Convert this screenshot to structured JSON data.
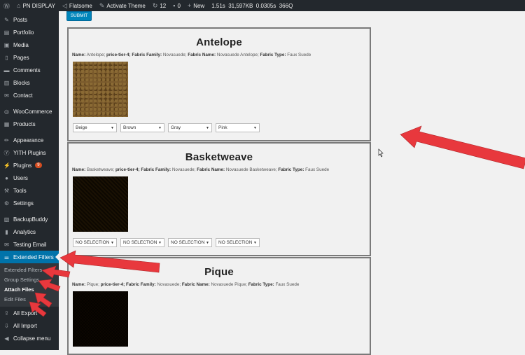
{
  "adminbar": {
    "wp_icon": "wordpress-icon",
    "site": "PN DISPLAY",
    "theme": "Flatsome",
    "activate": "Activate Theme",
    "updates": "12",
    "comments": "0",
    "new": "New",
    "perf": "1.51s  31,597KB  0.0305s  366Q"
  },
  "sidebar": {
    "items": [
      {
        "label": "Posts",
        "icon": "pin-icon"
      },
      {
        "label": "Portfolio",
        "icon": "portfolio-icon"
      },
      {
        "label": "Media",
        "icon": "media-icon"
      },
      {
        "label": "Pages",
        "icon": "pages-icon"
      },
      {
        "label": "Comments",
        "icon": "comments-icon"
      },
      {
        "label": "Blocks",
        "icon": "blocks-icon"
      },
      {
        "label": "Contact",
        "icon": "contact-icon"
      },
      {
        "label": "WooCommerce",
        "icon": "woo-icon"
      },
      {
        "label": "Products",
        "icon": "products-icon"
      },
      {
        "label": "Appearance",
        "icon": "brush-icon"
      },
      {
        "label": "YITH Plugins",
        "icon": "yith-icon"
      },
      {
        "label": "Plugins",
        "icon": "plug-icon",
        "badge": "9"
      },
      {
        "label": "Users",
        "icon": "users-icon"
      },
      {
        "label": "Tools",
        "icon": "wrench-icon"
      },
      {
        "label": "Settings",
        "icon": "settings-icon"
      },
      {
        "label": "BackupBuddy",
        "icon": "backup-icon"
      },
      {
        "label": "Analytics",
        "icon": "analytics-icon"
      },
      {
        "label": "Testing Email",
        "icon": "email-icon"
      },
      {
        "label": "Extended Filters",
        "icon": "filter-icon"
      }
    ],
    "submenu": [
      "Extended Filters",
      "Group Settings",
      "Attach Files",
      "Edit Files"
    ],
    "after": [
      {
        "label": "All Export",
        "icon": "export-icon"
      },
      {
        "label": "All Import",
        "icon": "import-icon"
      },
      {
        "label": "Collapse menu",
        "icon": "collapse-icon"
      }
    ]
  },
  "submit": "SUBMIT",
  "labels": {
    "name": "Name:",
    "tier": "price-tier-4;",
    "family": "Fabric Family:",
    "fname": "Fabric Name:",
    "ftype": "Fabric Type:"
  },
  "cards": [
    {
      "title": "Antelope",
      "name": "Antelope;",
      "family": "Novasuede;",
      "fname": "Novasuede Antelope;",
      "ftype": "Faux Suede",
      "selects": [
        "Beige",
        "Brown",
        "Gray",
        "Pink"
      ]
    },
    {
      "title": "Basketweave",
      "name": "Basketweave;",
      "family": "Novasuede;",
      "fname": "Novasuede Basketweave;",
      "ftype": "Faux Suede",
      "selects": [
        "NO SELECTION",
        "NO SELECTION",
        "NO SELECTION",
        "NO SELECTION"
      ]
    },
    {
      "title": "Pique",
      "name": "Pique;",
      "family": "Novasuede;",
      "fname": "Novasuede Pique;",
      "ftype": "Faux Suede",
      "selects": []
    }
  ],
  "colors": {
    "adminbar": "#23282d",
    "active": "#0073aa",
    "arrow": "#e8383d"
  }
}
